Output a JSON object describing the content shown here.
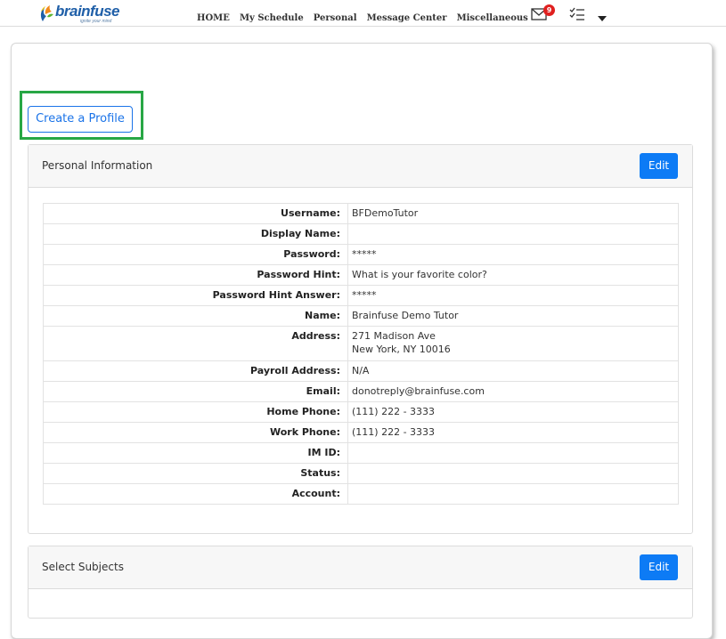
{
  "brand": {
    "name": "brainfuse",
    "tagline": "ignite your mind",
    "colors": {
      "blue": "#1f5fa8",
      "orange": "#f28a1b",
      "green": "#5cb531"
    }
  },
  "nav": {
    "links": [
      "HOME",
      "My Schedule",
      "Personal",
      "Message Center",
      "Miscellaneous"
    ],
    "mail_count": "9",
    "icons": [
      "mail-icon",
      "task-list-icon",
      "caret-down-icon"
    ]
  },
  "actions": {
    "create_profile": "Create a Profile"
  },
  "personal_info": {
    "title": "Personal Information",
    "edit_label": "Edit",
    "rows": [
      {
        "label": "Username:",
        "value": [
          "BFDemoTutor"
        ]
      },
      {
        "label": "Display Name:",
        "value": [
          ""
        ]
      },
      {
        "label": "Password:",
        "value": [
          "*****"
        ]
      },
      {
        "label": "Password Hint:",
        "value": [
          "What is your favorite color?"
        ]
      },
      {
        "label": "Password Hint Answer:",
        "value": [
          "*****"
        ]
      },
      {
        "label": "Name:",
        "value": [
          "Brainfuse Demo Tutor"
        ]
      },
      {
        "label": "Address:",
        "value": [
          "271 Madison Ave",
          "New York, NY 10016"
        ]
      },
      {
        "label": "Payroll Address:",
        "value": [
          "N/A"
        ]
      },
      {
        "label": "Email:",
        "value": [
          "donotreply@brainfuse.com"
        ]
      },
      {
        "label": "Home Phone:",
        "value": [
          "(111) 222 - 3333"
        ]
      },
      {
        "label": "Work Phone:",
        "value": [
          "(111) 222 - 3333"
        ]
      },
      {
        "label": "IM ID:",
        "value": [
          ""
        ]
      },
      {
        "label": "Status:",
        "value": [
          ""
        ]
      },
      {
        "label": "Account:",
        "value": [
          ""
        ]
      }
    ]
  },
  "subjects": {
    "title": "Select Subjects",
    "edit_label": "Edit"
  },
  "colors": {
    "primary": "#0d7bf5",
    "highlight": "#28a745",
    "badge": "#e0201f"
  }
}
